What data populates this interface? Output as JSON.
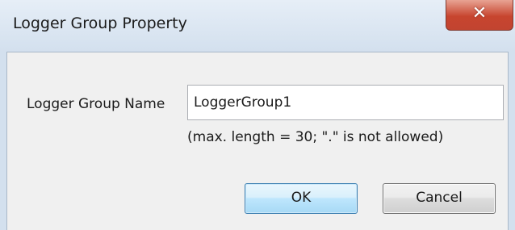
{
  "window": {
    "title": "Logger Group Property",
    "close_icon": "close-icon",
    "close_glyph": "✕"
  },
  "form": {
    "name_label": "Logger Group Name",
    "name_value": "LoggerGroup1",
    "hint": "(max. length = 30; \".\" is not allowed)"
  },
  "buttons": {
    "ok_label": "OK",
    "cancel_label": "Cancel"
  },
  "colors": {
    "titlebar": "#d3e0ee",
    "client_bg": "#f0f0f0",
    "close_button": "#c7452f",
    "ok_border": "#3c7fb1"
  }
}
